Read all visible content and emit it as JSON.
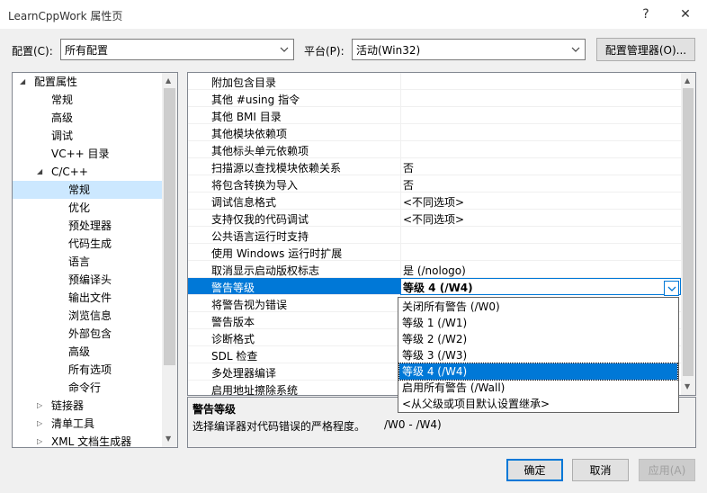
{
  "window": {
    "title": "LearnCppWork 属性页",
    "help": "?",
    "close": "✕"
  },
  "config_label": "配置(C):",
  "config_value": "所有配置",
  "platform_label": "平台(P):",
  "platform_value": "活动(Win32)",
  "config_manager_button": "配置管理器(O)...",
  "tree": [
    {
      "label": "配置属性",
      "exp": "◢"
    },
    {
      "label": "常规"
    },
    {
      "label": "高级"
    },
    {
      "label": "调试"
    },
    {
      "label": "VC++ 目录"
    },
    {
      "label": "C/C++",
      "exp": "◢"
    },
    {
      "label": "常规",
      "selected": true
    },
    {
      "label": "优化"
    },
    {
      "label": "预处理器"
    },
    {
      "label": "代码生成"
    },
    {
      "label": "语言"
    },
    {
      "label": "预编译头"
    },
    {
      "label": "输出文件"
    },
    {
      "label": "浏览信息"
    },
    {
      "label": "外部包含"
    },
    {
      "label": "高级"
    },
    {
      "label": "所有选项"
    },
    {
      "label": "命令行"
    },
    {
      "label": "链接器",
      "exp": "▷"
    },
    {
      "label": "清单工具",
      "exp": "▷"
    },
    {
      "label": "XML 文档生成器",
      "exp": "▷"
    }
  ],
  "properties": [
    {
      "name": "附加包含目录",
      "value": ""
    },
    {
      "name": "其他 #using 指令",
      "value": ""
    },
    {
      "name": "其他 BMI 目录",
      "value": ""
    },
    {
      "name": "其他模块依赖项",
      "value": ""
    },
    {
      "name": "其他标头单元依赖项",
      "value": ""
    },
    {
      "name": "扫描源以查找模块依赖关系",
      "value": "否"
    },
    {
      "name": "将包含转换为导入",
      "value": "否"
    },
    {
      "name": "调试信息格式",
      "value": "<不同选项>"
    },
    {
      "name": "支持仅我的代码调试",
      "value": "<不同选项>"
    },
    {
      "name": "公共语言运行时支持",
      "value": ""
    },
    {
      "name": "使用 Windows 运行时扩展",
      "value": ""
    },
    {
      "name": "取消显示启动版权标志",
      "value": "是 (/nologo)"
    },
    {
      "name": "警告等级",
      "value": "等级 4 (/W4)",
      "selected": true
    },
    {
      "name": "将警告视为错误",
      "value": ""
    },
    {
      "name": "警告版本",
      "value": ""
    },
    {
      "name": "诊断格式",
      "value": ""
    },
    {
      "name": "SDL 检查",
      "value": ""
    },
    {
      "name": "多处理器编译",
      "value": ""
    },
    {
      "name": "启用地址擦除系统",
      "value": ""
    }
  ],
  "dropdown_options": [
    {
      "label": "关闭所有警告 (/W0)"
    },
    {
      "label": "等级 1 (/W1)"
    },
    {
      "label": "等级 2 (/W2)"
    },
    {
      "label": "等级 3 (/W3)"
    },
    {
      "label": "等级 4 (/W4)",
      "selected": true
    },
    {
      "label": "启用所有警告 (/Wall)"
    },
    {
      "label": "<从父级或项目默认设置继承>"
    }
  ],
  "description": {
    "title": "警告等级",
    "text": "选择编译器对代码错误的严格程度。",
    "switches": "/W0 - /W4)"
  },
  "buttons": {
    "ok": "确定",
    "cancel": "取消",
    "apply": "应用(A)"
  }
}
